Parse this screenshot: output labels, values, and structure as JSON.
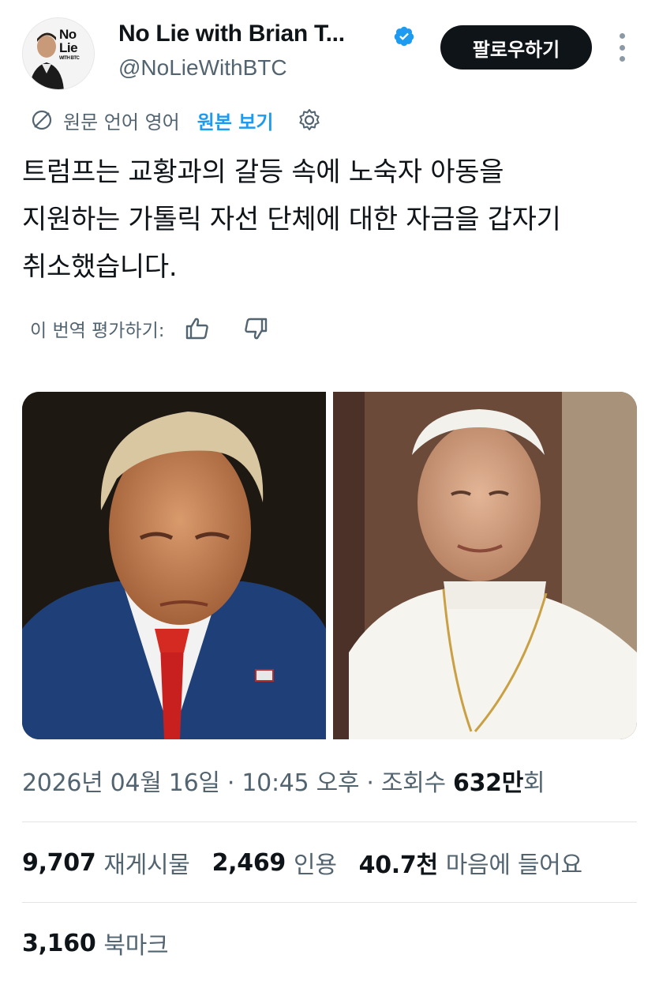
{
  "author": {
    "display_name": "No Lie with Brian T...",
    "handle": "@NoLieWithBTC",
    "avatar_logo_line1": "No",
    "avatar_logo_line2": "Lie",
    "avatar_logo_tag": "WITH BTC",
    "verified_color": "#1d9bf0"
  },
  "follow_label": "팔로우하기",
  "translation": {
    "source_label": "원문 언어 영어",
    "view_original": "원본 보기",
    "icons": [
      "translate-icon",
      "gear-icon"
    ]
  },
  "tweet": {
    "text_line1": "트럼프는 교황과의 갈등 속에 노숙자 아동을",
    "text_line2": "지원하는 가톨릭 자선 단체에 대한 자금을 갑자기",
    "text_line3": "취소했습니다."
  },
  "rate": {
    "label": "이 번역 평가하기:",
    "icons": [
      "thumbs-up-icon",
      "thumbs-down-icon"
    ]
  },
  "media": {
    "count": 2
  },
  "meta": {
    "timestamp": "2026년 04월 16일 · 10:45 오후 · 조회수 ",
    "views_num": "632만",
    "views_suffix": "회"
  },
  "stats": {
    "reposts_num": "9,707",
    "reposts_label": "재게시물",
    "quotes_num": "2,469",
    "quotes_label": "인용",
    "likes_num": "40.7천",
    "likes_label": "마음에 들어요",
    "bookmarks_num": "3,160",
    "bookmarks_label": "북마크"
  },
  "colors": {
    "text": "#0f1419",
    "muted": "#536471",
    "accent": "#1d9bf0",
    "divider": "#e1e5e8"
  }
}
